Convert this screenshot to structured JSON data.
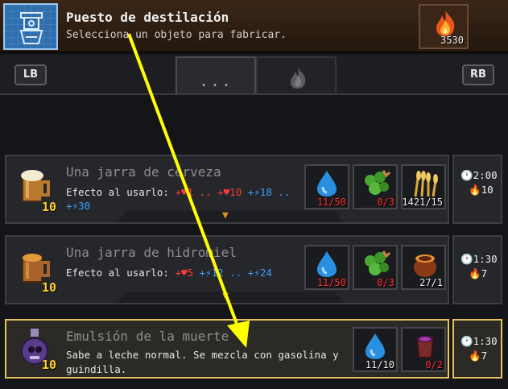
{
  "header": {
    "title": "Puesto de destilación",
    "subtitle": "Selecciona un objeto para fabricar.",
    "fuel_count": "3530",
    "station_icon": "distillery-icon",
    "fuel_icon": "fire-icon"
  },
  "tabs": {
    "left_shoulder": "LB",
    "right_shoulder": "RB",
    "active_tab": "...",
    "inactive_tab_icon": "fire-icon"
  },
  "recipes": [
    {
      "name": "Una jarra de cerveza",
      "quantity": "10",
      "icon": "beer-mug-icon",
      "effect_label": "Efecto al usarlo:",
      "effect_line1": [
        {
          "text": "+♥1 ..",
          "kind": "hp"
        },
        {
          "text": "+♥10",
          "kind": "hp"
        },
        {
          "text": "+⚡18 ..",
          "kind": "energy"
        }
      ],
      "effect_line2": [
        {
          "text": "+⚡30",
          "kind": "energy"
        }
      ],
      "ingredients": [
        {
          "icon": "water-drop-icon",
          "count": "11/50",
          "count_color": "red"
        },
        {
          "icon": "hops-icon",
          "count": "0/3",
          "count_color": "red"
        },
        {
          "icon": "wheat-icon",
          "count": "1421/15",
          "count_color": "white"
        }
      ],
      "time": "2:00",
      "heat": "10"
    },
    {
      "name": "Una jarra de hidromiel",
      "quantity": "10",
      "icon": "mead-mug-icon",
      "effect_label": "Efecto al usarlo:",
      "effect_line1": [
        {
          "text": "+♥5",
          "kind": "hp"
        },
        {
          "text": "+⚡12 ..",
          "kind": "energy"
        },
        {
          "text": "+⚡24",
          "kind": "energy"
        }
      ],
      "ingredients": [
        {
          "icon": "water-drop-icon",
          "count": "11/50",
          "count_color": "red"
        },
        {
          "icon": "hops-icon",
          "count": "0/3",
          "count_color": "red"
        },
        {
          "icon": "honey-pot-icon",
          "count": "27/1",
          "count_color": "white"
        }
      ],
      "time": "1:30",
      "heat": "7"
    },
    {
      "name": "Emulsión de la muerte",
      "quantity": "10",
      "icon": "death-potion-icon",
      "description": "Sabe a leche normal. Se mezcla con gasolina y guindilla.",
      "ingredients": [
        {
          "icon": "water-drop-icon",
          "count": "11/10",
          "count_color": "white"
        },
        {
          "icon": "jar-icon",
          "count": "0/2",
          "count_color": "red"
        }
      ],
      "time": "1:30",
      "heat": "7",
      "selected": true
    }
  ],
  "colors": {
    "highlight_border": "#e6c15c",
    "annotation_arrow": "#ffff00",
    "health": "#ff3a3a",
    "energy": "#3aa0ff"
  }
}
